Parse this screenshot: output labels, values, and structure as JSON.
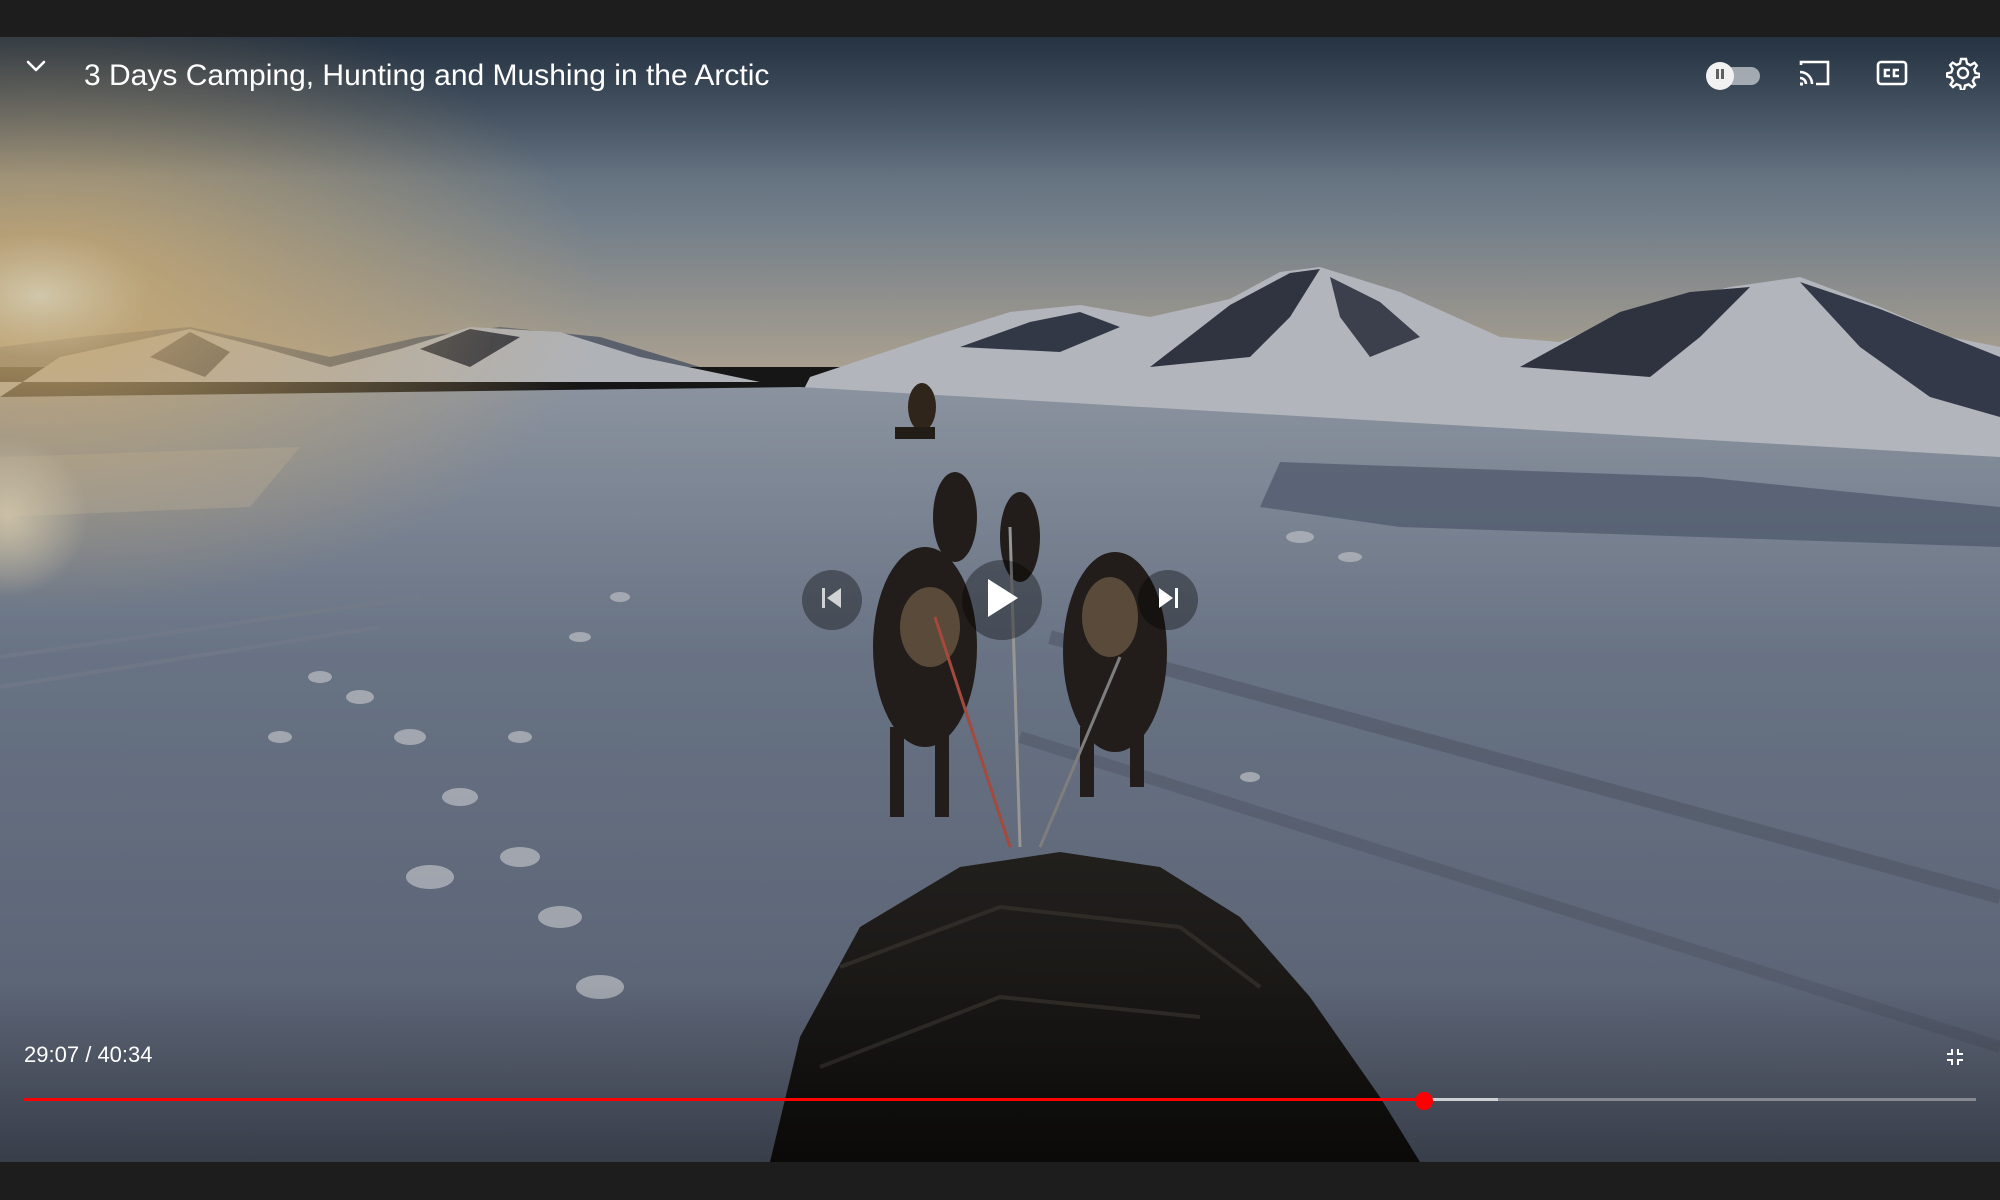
{
  "video": {
    "title": "3 Days Camping, Hunting and Mushing in the Arctic",
    "current_time": "29:07",
    "time_separator": "/",
    "duration": "40:34",
    "progress": {
      "played_fraction": 0.717,
      "buffered_fraction": 0.755
    }
  },
  "controls": {
    "autoplay_on": false,
    "icons": {
      "collapse": "chevron-down-icon",
      "autoplay": "pause-icon",
      "cast": "cast-icon",
      "captions": "closed-captions-icon",
      "settings": "gear-icon",
      "previous": "skip-previous-icon",
      "play": "play-icon",
      "next": "skip-next-icon",
      "exit_fullscreen": "exit-fullscreen-icon"
    }
  },
  "colors": {
    "progress_played": "#ff0000",
    "progress_track": "#ffffff",
    "chrome_bar": "#1d1d1e"
  }
}
